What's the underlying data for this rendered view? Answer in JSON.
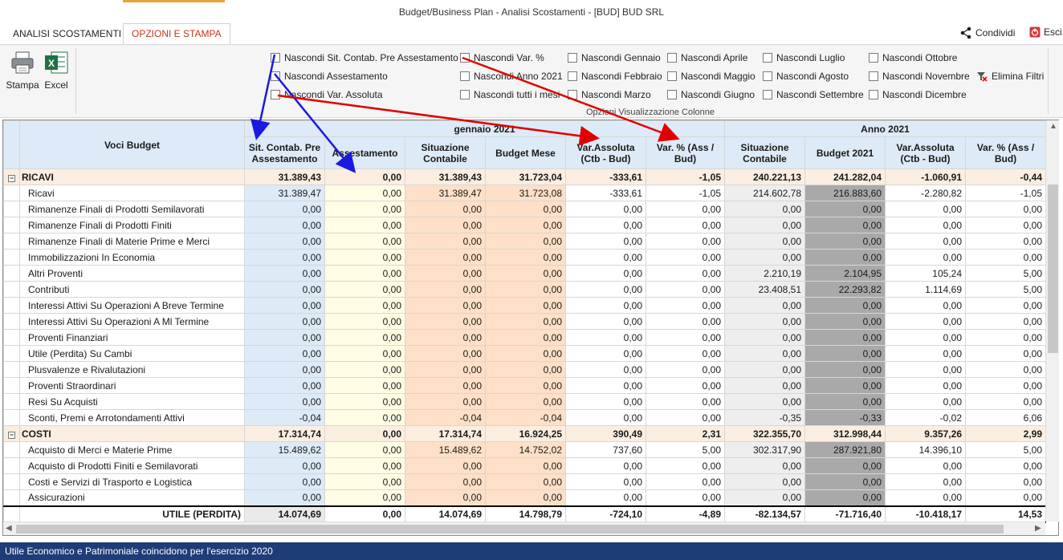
{
  "window": {
    "title": "Budget/Business Plan - Analisi Scostamenti - [BUD] BUD SRL"
  },
  "tabs": [
    {
      "label": "ANALISI SCOSTAMENTI",
      "active": false
    },
    {
      "label": "OPZIONI E STAMPA",
      "active": true
    }
  ],
  "topright": {
    "share_label": "Condividi",
    "exit_label": "Esci"
  },
  "ribbon": {
    "print_label": "Stampa",
    "excel_label": "Excel",
    "group_label": "Opzioni Visualizzazione Colonne",
    "clear_filters_label": "Elimina Filtri",
    "checkboxes": [
      "Nascondi Sit. Contab. Pre Assestamento",
      "Nascondi Assestamento",
      "Nascondi Var. Assoluta",
      "Nascondi Var. %",
      "Nascondi Anno 2021",
      "Nascondi tutti i mesi",
      "Nascondi Gennaio",
      "Nascondi Febbraio",
      "Nascondi Marzo",
      "Nascondi Aprile",
      "Nascondi Maggio",
      "Nascondi Giugno",
      "Nascondi Luglio",
      "Nascondi Agosto",
      "Nascondi Settembre",
      "Nascondi Ottobre",
      "Nascondi Novembre",
      "Nascondi Dicembre"
    ]
  },
  "grid": {
    "voci_header": "Voci Budget",
    "band_month": "gennaio 2021",
    "band_year": "Anno 2021",
    "columns": [
      "Sit. Contab. Pre Assestamento",
      "Assestamento",
      "Situazione Contabile",
      "Budget Mese",
      "Var.Assoluta (Ctb - Bud)",
      "Var. % (Ass / Bud)",
      "Situazione Contabile",
      "Budget 2021",
      "Var.Assoluta (Ctb - Bud)",
      "Var. % (Ass / Bud)"
    ],
    "rows": [
      {
        "type": "group",
        "expander": "⊟",
        "label": "RICAVI",
        "values": [
          "31.389,43",
          "0,00",
          "31.389,43",
          "31.723,04",
          "-333,61",
          "-1,05",
          "240.221,13",
          "241.282,04",
          "-1.060,91",
          "-0,44"
        ]
      },
      {
        "type": "item",
        "label": "Ricavi",
        "values": [
          "31.389,47",
          "0,00",
          "31.389,47",
          "31.723,08",
          "-333,61",
          "-1,05",
          "214.602,78",
          "216.883,60",
          "-2.280,82",
          "-1,05"
        ]
      },
      {
        "type": "item",
        "label": "Rimanenze Finali di Prodotti Semilavorati",
        "values": [
          "0,00",
          "0,00",
          "0,00",
          "0,00",
          "0,00",
          "0,00",
          "0,00",
          "0,00",
          "0,00",
          "0,00"
        ]
      },
      {
        "type": "item",
        "label": "Rimanenze Finali di Prodotti Finiti",
        "values": [
          "0,00",
          "0,00",
          "0,00",
          "0,00",
          "0,00",
          "0,00",
          "0,00",
          "0,00",
          "0,00",
          "0,00"
        ]
      },
      {
        "type": "item",
        "label": "Rimanenze Finali di Materie Prime e Merci",
        "values": [
          "0,00",
          "0,00",
          "0,00",
          "0,00",
          "0,00",
          "0,00",
          "0,00",
          "0,00",
          "0,00",
          "0,00"
        ]
      },
      {
        "type": "item",
        "label": "Immobilizzazioni In Economia",
        "values": [
          "0,00",
          "0,00",
          "0,00",
          "0,00",
          "0,00",
          "0,00",
          "0,00",
          "0,00",
          "0,00",
          "0,00"
        ]
      },
      {
        "type": "item",
        "label": "Altri Proventi",
        "values": [
          "0,00",
          "0,00",
          "0,00",
          "0,00",
          "0,00",
          "0,00",
          "2.210,19",
          "2.104,95",
          "105,24",
          "5,00"
        ]
      },
      {
        "type": "item",
        "label": "Contributi",
        "values": [
          "0,00",
          "0,00",
          "0,00",
          "0,00",
          "0,00",
          "0,00",
          "23.408,51",
          "22.293,82",
          "1.114,69",
          "5,00"
        ]
      },
      {
        "type": "item",
        "label": "Interessi Attivi Su Operazioni A Breve Termine",
        "values": [
          "0,00",
          "0,00",
          "0,00",
          "0,00",
          "0,00",
          "0,00",
          "0,00",
          "0,00",
          "0,00",
          "0,00"
        ]
      },
      {
        "type": "item",
        "label": "Interessi Attivi Su Operazioni A Ml Termine",
        "values": [
          "0,00",
          "0,00",
          "0,00",
          "0,00",
          "0,00",
          "0,00",
          "0,00",
          "0,00",
          "0,00",
          "0,00"
        ]
      },
      {
        "type": "item",
        "label": "Proventi Finanziari",
        "values": [
          "0,00",
          "0,00",
          "0,00",
          "0,00",
          "0,00",
          "0,00",
          "0,00",
          "0,00",
          "0,00",
          "0,00"
        ]
      },
      {
        "type": "item",
        "label": "Utile (Perdita) Su Cambi",
        "values": [
          "0,00",
          "0,00",
          "0,00",
          "0,00",
          "0,00",
          "0,00",
          "0,00",
          "0,00",
          "0,00",
          "0,00"
        ]
      },
      {
        "type": "item",
        "label": "Plusvalenze e Rivalutazioni",
        "values": [
          "0,00",
          "0,00",
          "0,00",
          "0,00",
          "0,00",
          "0,00",
          "0,00",
          "0,00",
          "0,00",
          "0,00"
        ]
      },
      {
        "type": "item",
        "label": "Proventi Straordinari",
        "values": [
          "0,00",
          "0,00",
          "0,00",
          "0,00",
          "0,00",
          "0,00",
          "0,00",
          "0,00",
          "0,00",
          "0,00"
        ]
      },
      {
        "type": "item",
        "label": "Resi Su Acquisti",
        "values": [
          "0,00",
          "0,00",
          "0,00",
          "0,00",
          "0,00",
          "0,00",
          "0,00",
          "0,00",
          "0,00",
          "0,00"
        ]
      },
      {
        "type": "item",
        "label": "Sconti, Premi e Arrotondamenti  Attivi",
        "values": [
          "-0,04",
          "0,00",
          "-0,04",
          "-0,04",
          "0,00",
          "0,00",
          "-0,35",
          "-0,33",
          "-0,02",
          "6,06"
        ]
      },
      {
        "type": "group",
        "expander": "⊟",
        "label": "COSTI",
        "values": [
          "17.314,74",
          "0,00",
          "17.314,74",
          "16.924,25",
          "390,49",
          "2,31",
          "322.355,70",
          "312.998,44",
          "9.357,26",
          "2,99"
        ]
      },
      {
        "type": "item",
        "label": "Acquisto di Merci e Materie Prime",
        "values": [
          "15.489,62",
          "0,00",
          "15.489,62",
          "14.752,02",
          "737,60",
          "5,00",
          "302.317,90",
          "287.921,80",
          "14.396,10",
          "5,00"
        ]
      },
      {
        "type": "item",
        "label": "Acquisto di Prodotti Finiti e Semilavorati",
        "values": [
          "0,00",
          "0,00",
          "0,00",
          "0,00",
          "0,00",
          "0,00",
          "0,00",
          "0,00",
          "0,00",
          "0,00"
        ]
      },
      {
        "type": "item",
        "label": "Costi e Servizi di Trasporto e Logistica",
        "values": [
          "0,00",
          "0,00",
          "0,00",
          "0,00",
          "0,00",
          "0,00",
          "0,00",
          "0,00",
          "0,00",
          "0,00"
        ]
      },
      {
        "type": "item",
        "label": "Assicurazioni",
        "values": [
          "0,00",
          "0,00",
          "0,00",
          "0,00",
          "0,00",
          "0,00",
          "0,00",
          "0,00",
          "0,00",
          "0,00"
        ]
      }
    ],
    "total": {
      "label": "UTILE (PERDITA)",
      "values": [
        "14.074,69",
        "0,00",
        "14.074,69",
        "14.798,79",
        "-724,10",
        "-4,89",
        "-82.134,57",
        "-71.716,40",
        "-10.418,17",
        "14,53"
      ]
    }
  },
  "status": {
    "text": "Utile Economico e Patrimoniale coincidono per l'esercizio 2020"
  },
  "colors": {
    "status_bar": "#1e3c78",
    "accent": "#c0391b",
    "arrow_red": "#e00000",
    "arrow_blue": "#1a1adf"
  }
}
